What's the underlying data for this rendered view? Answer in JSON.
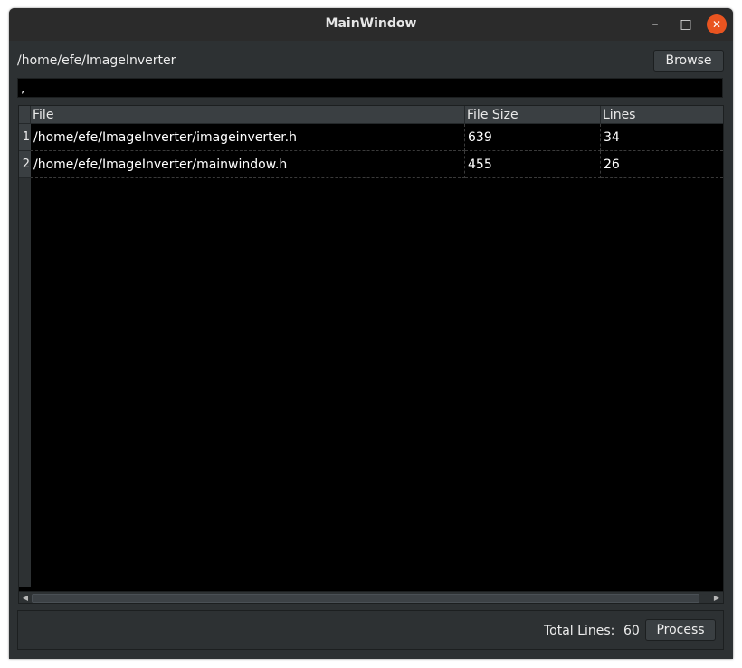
{
  "window": {
    "title": "MainWindow",
    "minimize_glyph": "–",
    "maximize_glyph": "□",
    "close_glyph": "✕"
  },
  "toolbar": {
    "path": "/home/efe/ImageInverter",
    "browse_label": "Browse"
  },
  "filter": {
    "value": ","
  },
  "table": {
    "headers": [
      "File",
      "File Size",
      "Lines"
    ],
    "rows": [
      {
        "num": "1",
        "file": "/home/efe/ImageInverter/imageinverter.h",
        "size": "639",
        "lines": "34"
      },
      {
        "num": "2",
        "file": "/home/efe/ImageInverter/mainwindow.h",
        "size": "455",
        "lines": "26"
      }
    ]
  },
  "footer": {
    "total_label": "Total Lines:",
    "total_value": "60",
    "process_label": "Process"
  },
  "colors": {
    "accent_close": "#e95420",
    "window_bg": "#2d3133",
    "table_bg": "#000000"
  }
}
